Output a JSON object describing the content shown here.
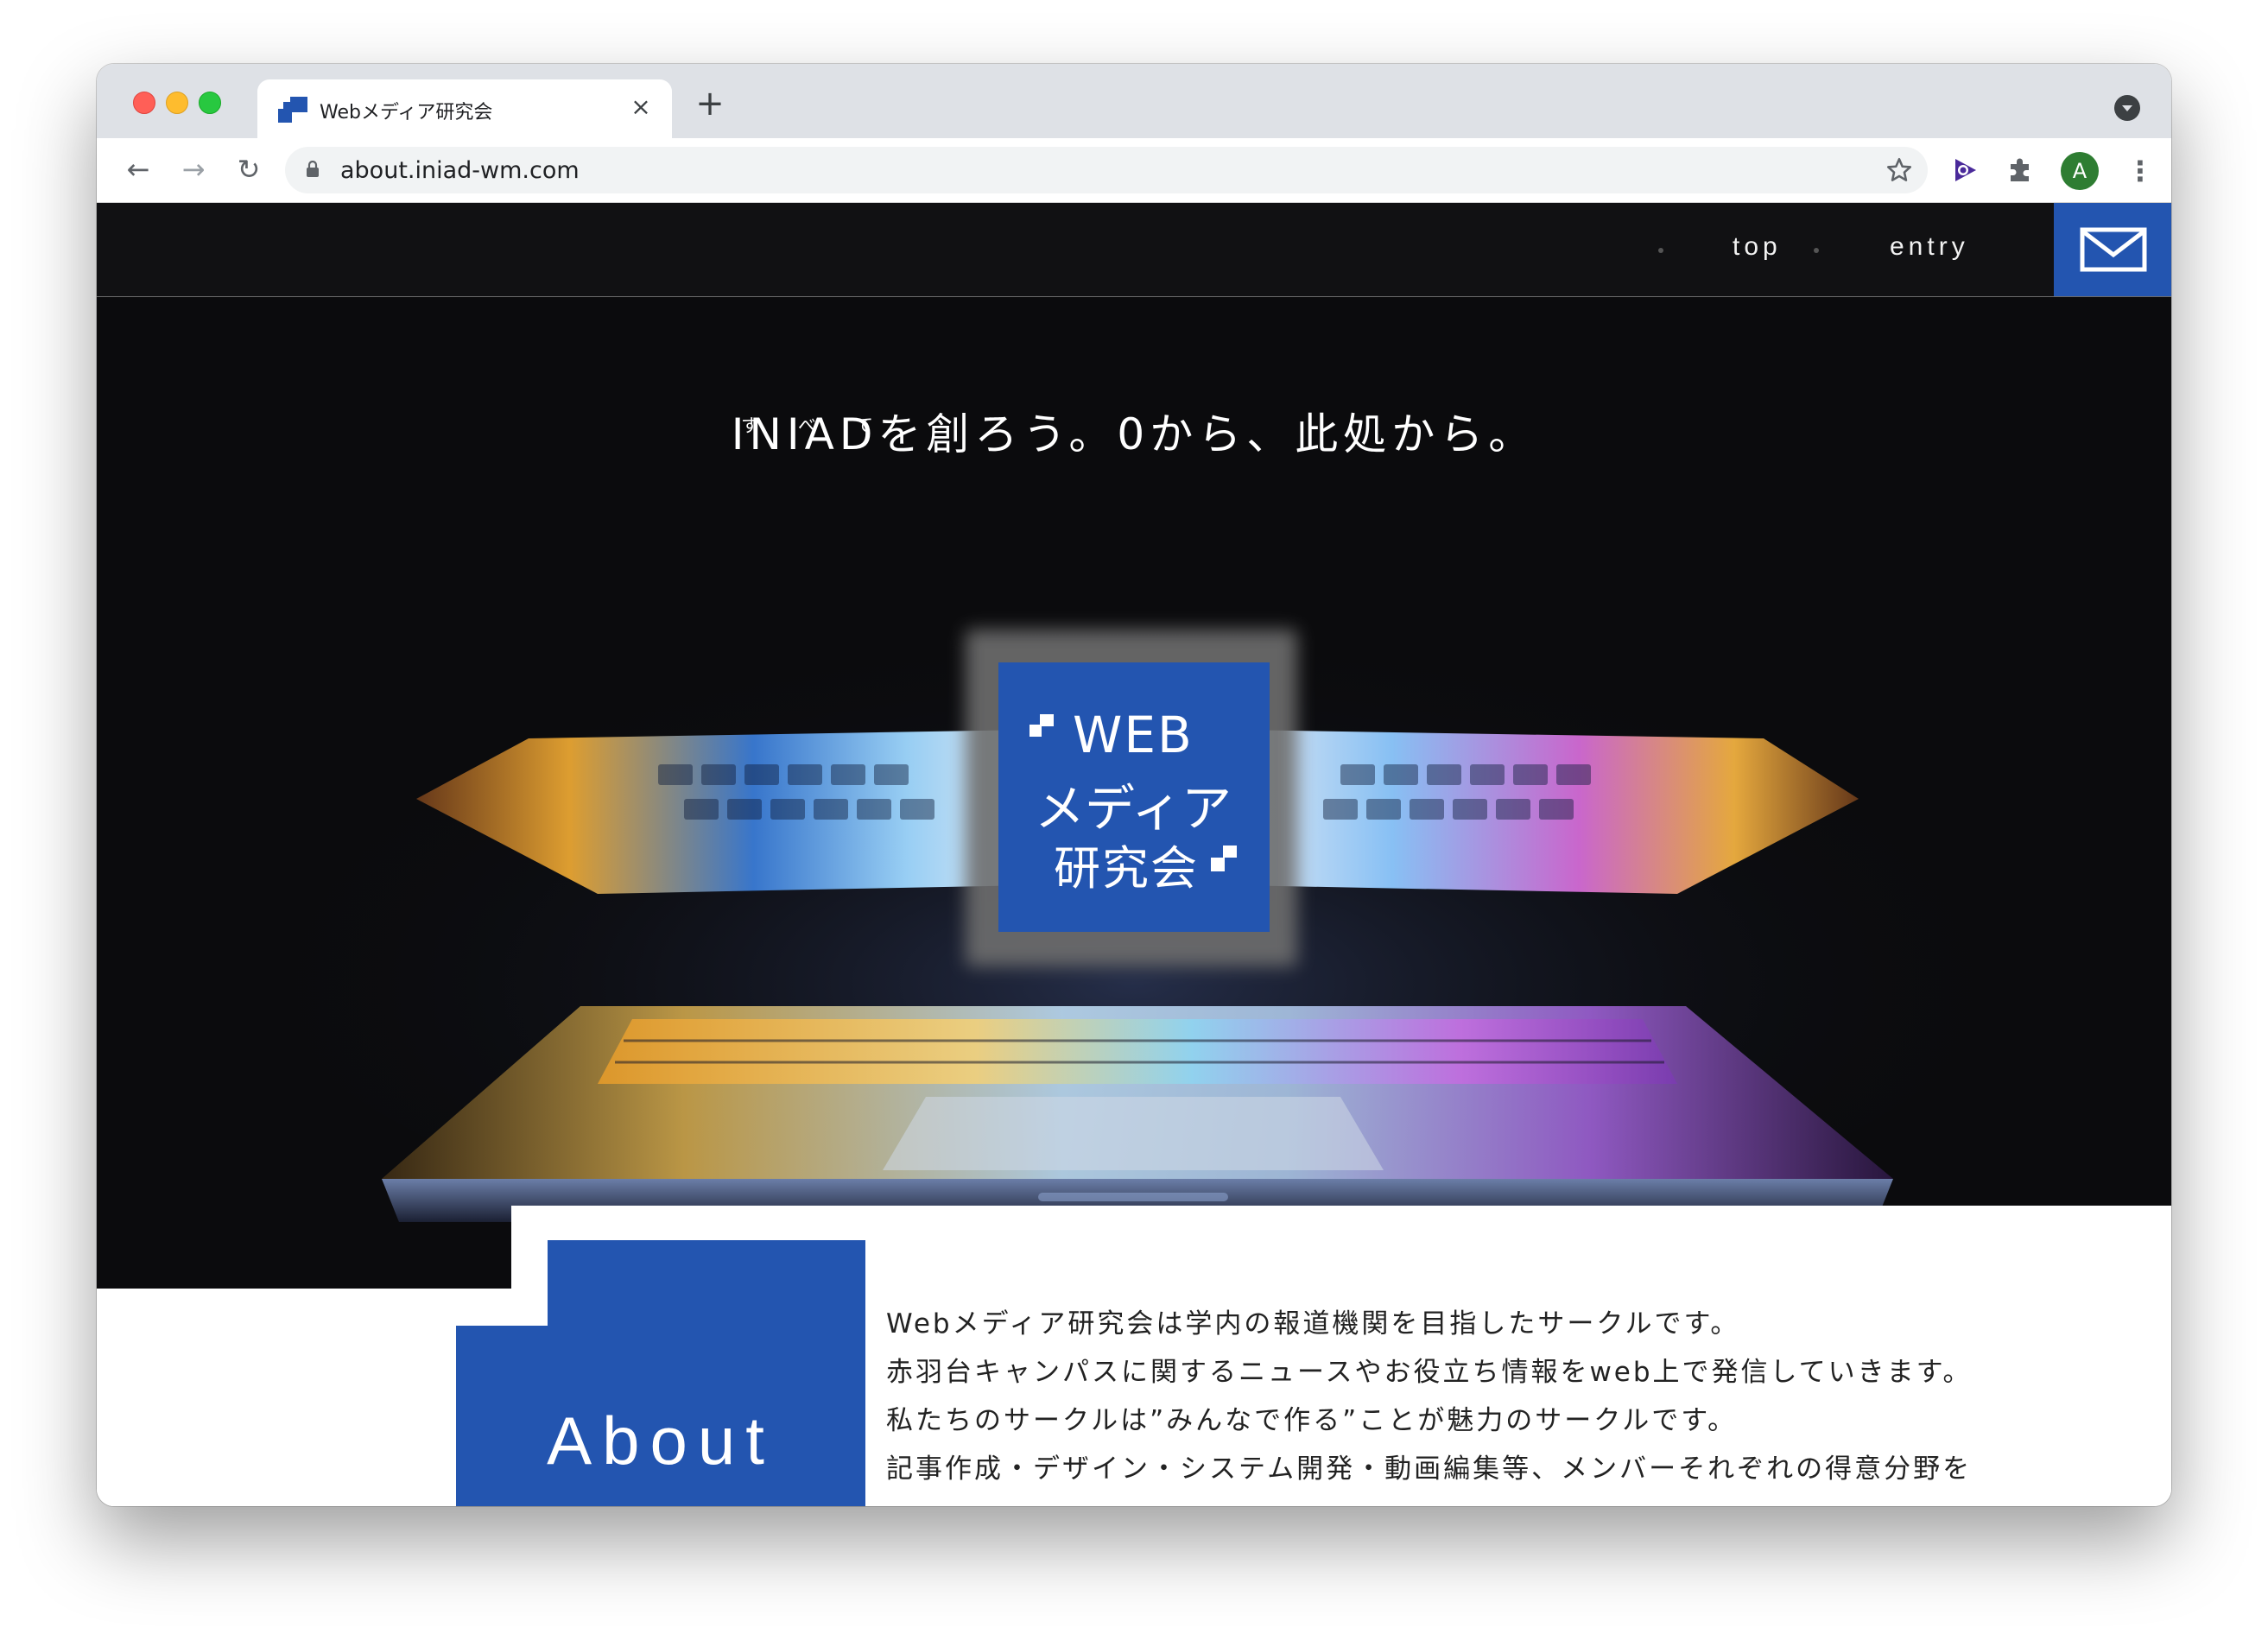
{
  "browser": {
    "tab_title": "Webメディア研究会",
    "tab_close_glyph": "×",
    "new_tab_glyph": "+",
    "url": "about.iniad-wm.com",
    "profile_initial": "A",
    "back_glyph": "←",
    "forward_glyph": "→",
    "reload_glyph": "↻",
    "menu_glyph": "⋮"
  },
  "header": {
    "nav": [
      {
        "label": "top"
      },
      {
        "label": "entry"
      }
    ],
    "mail_icon": "mail-icon"
  },
  "hero": {
    "tagline_main": "INIADを創ろう。0から、此処から。",
    "tagline_ruby": [
      "す",
      "べ",
      "て"
    ],
    "logo": {
      "line1": "WEB",
      "line2": "メディア",
      "line3": "研究会"
    }
  },
  "about": {
    "heading": "About",
    "paragraphs": [
      "Webメディア研究会は学内の報道機関を目指したサークルです。",
      "赤羽台キャンパスに関するニュースやお役立ち情報をweb上で発信していきます。",
      "私たちのサークルは”みんなで作る”ことが魅力のサークルです。",
      "記事作成・デザイン・システム開発・動画編集等、メンバーそれぞれの得意分野を"
    ]
  },
  "colors": {
    "brand_blue": "#2355b0",
    "header_bg": "#111113",
    "hero_bg": "#0b0b0d"
  }
}
